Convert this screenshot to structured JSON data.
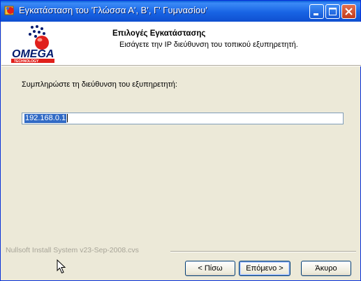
{
  "window": {
    "title": "Εγκατάσταση του 'Γλώσσα Α', Β', Γ' Γυμνασίου'",
    "title_icon": "installer-app-icon",
    "controls": [
      "minimize-icon",
      "maximize-icon",
      "close-icon"
    ]
  },
  "header": {
    "logo_text": "OMEGA",
    "logo_subtext": "TECHNOLOGY",
    "title": "Επιλογές Εγκατάστασης",
    "subtitle": "Εισάγετε την IP διεύθυνση του τοπικού εξυπηρετητή."
  },
  "body": {
    "prompt": "Συμπληρώστε τη διεύθυνση του εξυπηρετητή:",
    "ip_input_value": "192.168.0.1"
  },
  "footer": {
    "branding": "Nullsoft Install System v23-Sep-2008.cvs",
    "back_label": "< Πίσω",
    "next_label": "Επόμενο >",
    "cancel_label": "Άκυρο"
  },
  "colors": {
    "titlebar": "#1864e4",
    "window_bg": "#ece9d8",
    "selection": "#316ac5",
    "close_button": "#c13b1c",
    "logo_red": "#e0201b",
    "logo_navy": "#001a6e"
  }
}
